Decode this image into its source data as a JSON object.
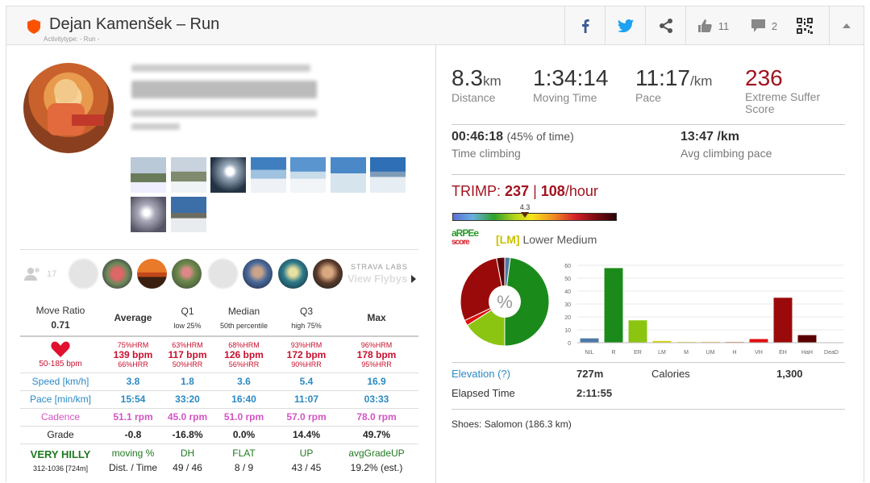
{
  "header": {
    "title": "Dejan Kamenšek – Run",
    "subtitle": "Activitytype: - Run -",
    "kudos": "11",
    "comments": "2"
  },
  "flyby": {
    "count": "17",
    "strava_labs": "STRAVA LABS",
    "view": "View Flybys"
  },
  "table": {
    "head": [
      "Move Ratio",
      "Average",
      "Q1",
      "Median",
      "Q3",
      "Max"
    ],
    "move_ratio": "0.71",
    "subhead": [
      "low 25%",
      "50th percentile",
      "high 75%"
    ],
    "hr_range": "50-185 bpm",
    "hr": [
      {
        "top": "75%HRM",
        "mid": "139 bpm",
        "bot": "66%HRR"
      },
      {
        "top": "63%HRM",
        "mid": "117 bpm",
        "bot": "50%HRR"
      },
      {
        "top": "68%HRM",
        "mid": "126 bpm",
        "bot": "56%HRR"
      },
      {
        "top": "93%HRM",
        "mid": "172 bpm",
        "bot": "90%HRR"
      },
      {
        "top": "96%HRM",
        "mid": "178 bpm",
        "bot": "95%HRR"
      }
    ],
    "speed": {
      "label": "Speed [km/h]",
      "values": [
        "3.8",
        "1.8",
        "3.6",
        "5.4",
        "16.9"
      ]
    },
    "pace": {
      "label": "Pace [min/km]",
      "values": [
        "15:54",
        "33:20",
        "16:40",
        "11:07",
        "03:33"
      ]
    },
    "cadence": {
      "label": "Cadence",
      "values": [
        "51.1 rpm",
        "45.0 rpm",
        "51.0 rpm",
        "57.0 rpm",
        "78.0 rpm"
      ]
    },
    "grade": {
      "label": "Grade",
      "values": [
        "-0.8",
        "-16.8%",
        "0.0%",
        "14.4%",
        "49.7%"
      ]
    },
    "hilly": {
      "label": "VERY HILLY",
      "sub": "312-1036 [724m]",
      "head": [
        "moving %",
        "DH",
        "FLAT",
        "UP",
        "avgGradeUP"
      ],
      "dist_label": "Dist. / Time",
      "values": [
        "49 / 46",
        "8 / 9",
        "43 / 45",
        "19.2% (est.)"
      ]
    }
  },
  "summary": {
    "distance": {
      "value": "8.3",
      "unit": "km",
      "label": "Distance"
    },
    "moving_time": {
      "value": "1:34:14",
      "label": "Moving Time"
    },
    "pace": {
      "value": "11:17",
      "unit": "/km",
      "label": "Pace"
    },
    "suffer": {
      "value": "236",
      "label": "Extreme Suffer Score"
    },
    "climb_time": {
      "value": "00:46:18",
      "pct": "(45% of time)",
      "label": "Time climbing"
    },
    "climb_pace": {
      "value": "13:47 /km",
      "label": "Avg climbing pace"
    }
  },
  "trimp": {
    "label": "TRIMP:",
    "value": "237",
    "sep": "|",
    "per_hour": "108",
    "per_hour_unit": "/hour",
    "marker": "4.3",
    "marker_fraction": 0.44
  },
  "arpee": {
    "logo_top": "aRPEe",
    "logo_bot": "score",
    "code": "[LM]",
    "label": "Lower Medium"
  },
  "donut": {
    "center": "%",
    "slices": [
      {
        "value": 48,
        "color": "#1a8a1a"
      },
      {
        "value": 16,
        "color": "#8cc511"
      },
      {
        "value": 2,
        "color": "#e01010"
      },
      {
        "value": 29,
        "color": "#9b0a0a"
      },
      {
        "value": 3,
        "color": "#5b0000"
      },
      {
        "value": 2,
        "color": "#4e79a7"
      }
    ]
  },
  "chart_data": {
    "type": "bar",
    "categories": [
      "NIL",
      "R",
      "ER",
      "LM",
      "M",
      "UM",
      "H",
      "VH",
      "EH",
      "HaH",
      "DeaD"
    ],
    "values": [
      3.5,
      58,
      17.5,
      1.5,
      0.7,
      0.7,
      0.7,
      3,
      35,
      6,
      0.3
    ],
    "colors": [
      "#4e79a7",
      "#1a8a1a",
      "#8cc511",
      "#d4d400",
      "#e8c000",
      "#e89a20",
      "#e86020",
      "#e01010",
      "#9b0a0a",
      "#5b0000",
      "#222222"
    ],
    "yticks": [
      "0",
      "10",
      "20",
      "30",
      "40",
      "50",
      "60"
    ],
    "ylim": [
      0,
      60
    ]
  },
  "details": {
    "elevation_label": "Elevation (?)",
    "elevation": "727m",
    "calories_label": "Calories",
    "calories": "1,300",
    "elapsed_label": "Elapsed Time",
    "elapsed": "2:11:55",
    "shoes": "Shoes: Salomon (186.3 km)"
  }
}
